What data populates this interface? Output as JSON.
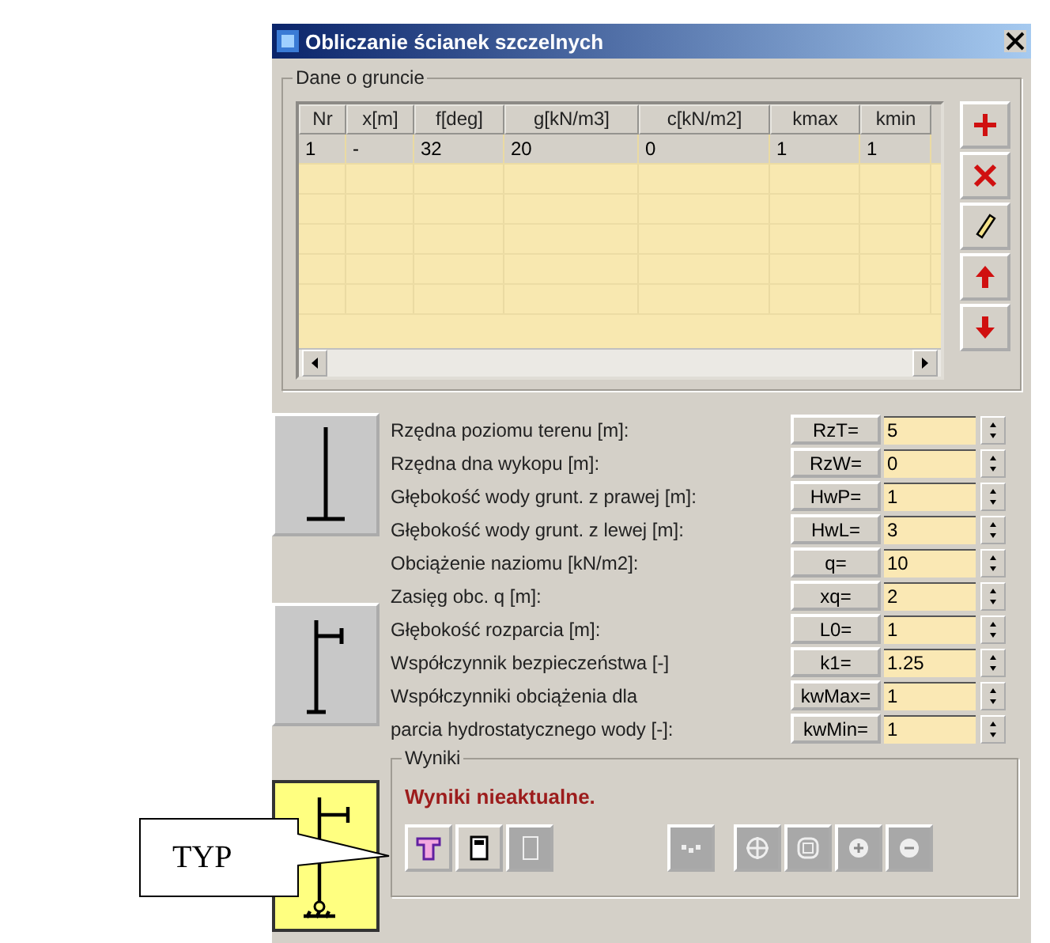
{
  "window": {
    "title": "Obliczanie ścianek szczelnych"
  },
  "soil_group": {
    "title": "Dane o gruncie",
    "columns": [
      "Nr",
      "x[m]",
      "f[deg]",
      "g[kN/m3]",
      "c[kN/m2]",
      "kmax",
      "kmin"
    ],
    "rows": [
      {
        "selected": true,
        "cells": [
          "1",
          "-",
          "32",
          "20",
          "0",
          "1",
          "1"
        ]
      }
    ]
  },
  "wall_types": [
    {
      "kind": "cantilever",
      "selected": false
    },
    {
      "kind": "strutted",
      "selected": false
    },
    {
      "kind": "strutted_supported",
      "selected": true
    }
  ],
  "params": [
    {
      "label": "Rzędna poziomu terenu [m]:",
      "symbol": "RzT=",
      "value": "5"
    },
    {
      "label": "Rzędna dna wykopu [m]:",
      "symbol": "RzW=",
      "value": "0"
    },
    {
      "label": "Głębokość wody grunt. z prawej [m]:",
      "symbol": "HwP=",
      "value": "1"
    },
    {
      "label": "Głębokość wody grunt. z lewej [m]:",
      "symbol": "HwL=",
      "value": "3"
    },
    {
      "label": "Obciążenie naziomu [kN/m2]:",
      "symbol": "q=",
      "value": "10"
    },
    {
      "label": "Zasięg obc. q [m]:",
      "symbol": "xq=",
      "value": "2"
    },
    {
      "label": "Głębokość rozparcia [m]:",
      "symbol": "L0=",
      "value": "1"
    },
    {
      "label": "Współczynnik bezpieczeństwa [-]",
      "symbol": "k1=",
      "value": "1.25"
    },
    {
      "label": "Współczynniki obciążenia dla",
      "symbol": "kwMax=",
      "value": "1"
    },
    {
      "label": "parcia hydrostatycznego wody [-]:",
      "symbol": "kwMin=",
      "value": "1"
    }
  ],
  "results": {
    "title": "Wyniki",
    "message": "Wyniki nieaktualne.",
    "buttons": [
      {
        "kind": "wall",
        "disabled": false
      },
      {
        "kind": "calculator",
        "disabled": false
      },
      {
        "kind": "page",
        "disabled": true
      },
      {
        "kind": "dots",
        "disabled": true
      },
      {
        "kind": "crosshair",
        "disabled": true
      },
      {
        "kind": "refresh",
        "disabled": true
      },
      {
        "kind": "plus",
        "disabled": true
      },
      {
        "kind": "minus",
        "disabled": true
      }
    ]
  },
  "callout": {
    "text": "TYP"
  }
}
